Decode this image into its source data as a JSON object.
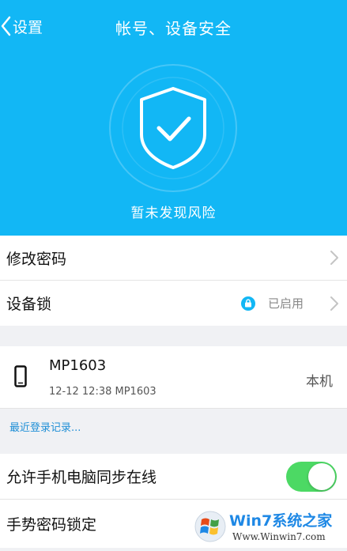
{
  "header": {
    "back_label": "设置",
    "title": "帐号、设备安全"
  },
  "security": {
    "status_text": "暂未发现风险"
  },
  "menu": {
    "change_password": "修改密码",
    "device_lock": "设备锁",
    "device_lock_status": "已启用"
  },
  "device": {
    "name": "MP1603",
    "last_login": "12-12 12:38 MP1603",
    "this_device_label": "本机"
  },
  "recent_login_link": "最近登录记录...",
  "settings": {
    "sync_online_label": "允许手机电脑同步在线",
    "sync_online_enabled": true,
    "gesture_lock_label": "手势密码锁定"
  },
  "watermark": {
    "brand": "Win7系统之家",
    "url": "Www.Winwin7.com"
  },
  "colors": {
    "accent": "#12b7f5",
    "toggle_on": "#4cd964",
    "link": "#1f8fd6"
  }
}
